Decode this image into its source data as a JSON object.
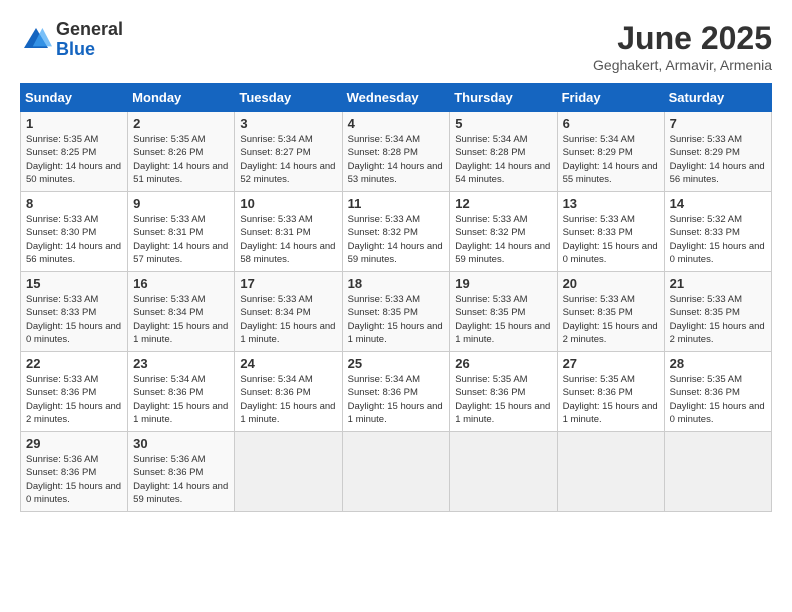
{
  "header": {
    "logo_general": "General",
    "logo_blue": "Blue",
    "month_title": "June 2025",
    "location": "Geghakert, Armavir, Armenia"
  },
  "calendar": {
    "days_of_week": [
      "Sunday",
      "Monday",
      "Tuesday",
      "Wednesday",
      "Thursday",
      "Friday",
      "Saturday"
    ],
    "weeks": [
      [
        {
          "day": "1",
          "sunrise": "5:35 AM",
          "sunset": "8:25 PM",
          "daylight": "14 hours and 50 minutes."
        },
        {
          "day": "2",
          "sunrise": "5:35 AM",
          "sunset": "8:26 PM",
          "daylight": "14 hours and 51 minutes."
        },
        {
          "day": "3",
          "sunrise": "5:34 AM",
          "sunset": "8:27 PM",
          "daylight": "14 hours and 52 minutes."
        },
        {
          "day": "4",
          "sunrise": "5:34 AM",
          "sunset": "8:28 PM",
          "daylight": "14 hours and 53 minutes."
        },
        {
          "day": "5",
          "sunrise": "5:34 AM",
          "sunset": "8:28 PM",
          "daylight": "14 hours and 54 minutes."
        },
        {
          "day": "6",
          "sunrise": "5:34 AM",
          "sunset": "8:29 PM",
          "daylight": "14 hours and 55 minutes."
        },
        {
          "day": "7",
          "sunrise": "5:33 AM",
          "sunset": "8:29 PM",
          "daylight": "14 hours and 56 minutes."
        }
      ],
      [
        {
          "day": "8",
          "sunrise": "5:33 AM",
          "sunset": "8:30 PM",
          "daylight": "14 hours and 56 minutes."
        },
        {
          "day": "9",
          "sunrise": "5:33 AM",
          "sunset": "8:31 PM",
          "daylight": "14 hours and 57 minutes."
        },
        {
          "day": "10",
          "sunrise": "5:33 AM",
          "sunset": "8:31 PM",
          "daylight": "14 hours and 58 minutes."
        },
        {
          "day": "11",
          "sunrise": "5:33 AM",
          "sunset": "8:32 PM",
          "daylight": "14 hours and 59 minutes."
        },
        {
          "day": "12",
          "sunrise": "5:33 AM",
          "sunset": "8:32 PM",
          "daylight": "14 hours and 59 minutes."
        },
        {
          "day": "13",
          "sunrise": "5:33 AM",
          "sunset": "8:33 PM",
          "daylight": "15 hours and 0 minutes."
        },
        {
          "day": "14",
          "sunrise": "5:32 AM",
          "sunset": "8:33 PM",
          "daylight": "15 hours and 0 minutes."
        }
      ],
      [
        {
          "day": "15",
          "sunrise": "5:33 AM",
          "sunset": "8:33 PM",
          "daylight": "15 hours and 0 minutes."
        },
        {
          "day": "16",
          "sunrise": "5:33 AM",
          "sunset": "8:34 PM",
          "daylight": "15 hours and 1 minute."
        },
        {
          "day": "17",
          "sunrise": "5:33 AM",
          "sunset": "8:34 PM",
          "daylight": "15 hours and 1 minute."
        },
        {
          "day": "18",
          "sunrise": "5:33 AM",
          "sunset": "8:35 PM",
          "daylight": "15 hours and 1 minute."
        },
        {
          "day": "19",
          "sunrise": "5:33 AM",
          "sunset": "8:35 PM",
          "daylight": "15 hours and 1 minute."
        },
        {
          "day": "20",
          "sunrise": "5:33 AM",
          "sunset": "8:35 PM",
          "daylight": "15 hours and 2 minutes."
        },
        {
          "day": "21",
          "sunrise": "5:33 AM",
          "sunset": "8:35 PM",
          "daylight": "15 hours and 2 minutes."
        }
      ],
      [
        {
          "day": "22",
          "sunrise": "5:33 AM",
          "sunset": "8:36 PM",
          "daylight": "15 hours and 2 minutes."
        },
        {
          "day": "23",
          "sunrise": "5:34 AM",
          "sunset": "8:36 PM",
          "daylight": "15 hours and 1 minute."
        },
        {
          "day": "24",
          "sunrise": "5:34 AM",
          "sunset": "8:36 PM",
          "daylight": "15 hours and 1 minute."
        },
        {
          "day": "25",
          "sunrise": "5:34 AM",
          "sunset": "8:36 PM",
          "daylight": "15 hours and 1 minute."
        },
        {
          "day": "26",
          "sunrise": "5:35 AM",
          "sunset": "8:36 PM",
          "daylight": "15 hours and 1 minute."
        },
        {
          "day": "27",
          "sunrise": "5:35 AM",
          "sunset": "8:36 PM",
          "daylight": "15 hours and 1 minute."
        },
        {
          "day": "28",
          "sunrise": "5:35 AM",
          "sunset": "8:36 PM",
          "daylight": "15 hours and 0 minutes."
        }
      ],
      [
        {
          "day": "29",
          "sunrise": "5:36 AM",
          "sunset": "8:36 PM",
          "daylight": "15 hours and 0 minutes."
        },
        {
          "day": "30",
          "sunrise": "5:36 AM",
          "sunset": "8:36 PM",
          "daylight": "14 hours and 59 minutes."
        },
        null,
        null,
        null,
        null,
        null
      ]
    ]
  }
}
